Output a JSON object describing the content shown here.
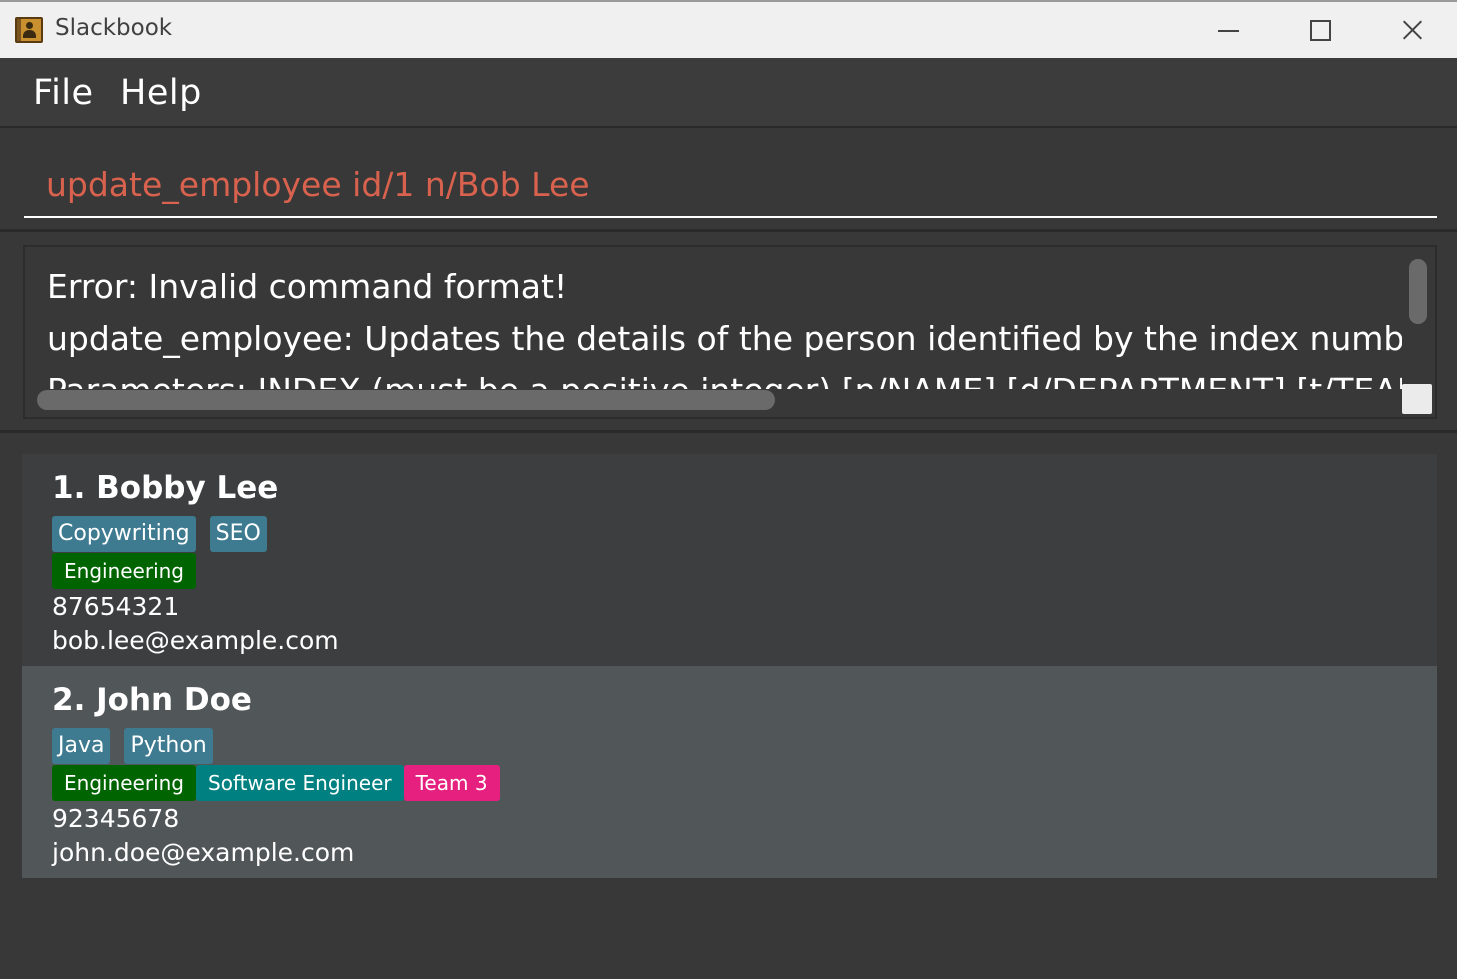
{
  "window": {
    "title": "Slackbook",
    "icon": "address-book-icon",
    "controls": {
      "minimize": "minimize-icon",
      "maximize": "maximize-icon",
      "close": "close-icon"
    }
  },
  "menu": {
    "file": "File",
    "help": "Help"
  },
  "command": {
    "value": "update_employee id/1 n/Bob Lee"
  },
  "result": {
    "lines": [
      "Error: Invalid command format!",
      "update_employee: Updates the details of the person identified by the index number used in th",
      "Parameters: INDEX (must be a positive integer) [n/NAME] [d/DEPARTMENT] [t/TEAM] [r/ROLE"
    ]
  },
  "persons": [
    {
      "name": "1. Bobby Lee",
      "skills": [
        "Copywriting",
        "SEO"
      ],
      "department": "Engineering",
      "phone": "87654321",
      "email": "bob.lee@example.com"
    },
    {
      "name": "2. John Doe",
      "skills": [
        "Java",
        "Python"
      ],
      "department": "Engineering",
      "role": "Software Engineer",
      "team": "Team 3",
      "phone": "92345678",
      "email": "john.doe@example.com"
    }
  ],
  "colors": {
    "command_text": "#d8624e",
    "skill_tag": "#3e7b91",
    "department_tag": "#006400",
    "role_tag": "#008080",
    "team_tag": "#e6207e",
    "selected_card": "#515658"
  }
}
